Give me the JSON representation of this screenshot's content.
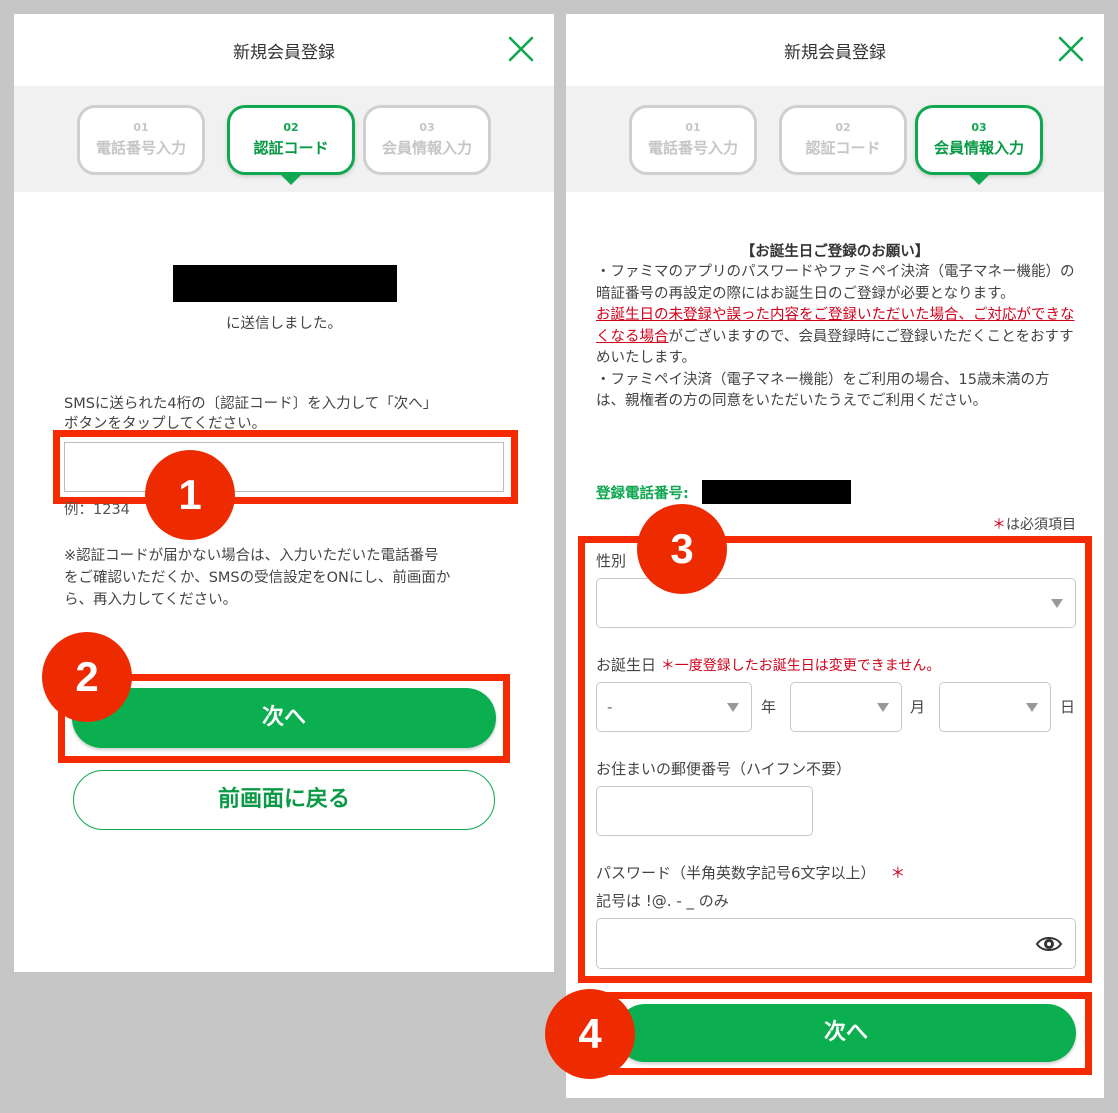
{
  "header": {
    "title": "新規会員登録"
  },
  "steps": [
    {
      "num": "01",
      "label": "電話番号入力"
    },
    {
      "num": "02",
      "label": "認証コード"
    },
    {
      "num": "03",
      "label": "会員情報入力"
    }
  ],
  "left": {
    "sent_text": "に送信しました。",
    "instruction_line1": "SMSに送られた4桁の〔認証コード〕を入力して「次へ」",
    "instruction_line2": "ボタンをタップしてください。",
    "example": "例：1234",
    "note_line1": "※認証コードが届かない場合は、入力いただいた電話番号",
    "note_line2": "をご確認いただくか、SMSの受信設定をONにし、前画面か",
    "note_line3": "ら、再入力してください。",
    "next_label": "次へ",
    "back_label": "前画面に戻る"
  },
  "right": {
    "notice_title": "【お誕生日ご登録のお願い】",
    "notice_p1": "・ファミマのアプリのパスワードやファミペイ決済（電子マネー機能）の暗証番号の再設定の際にはお誕生日のご登録が必要となります。",
    "notice_warn": "お誕生日の未登録や誤った内容をご登録いただいた場合、ご対応ができなくなる場合",
    "notice_p2_rest": "がございますので、会員登録時にご登録いただくことをおすすめいたします。",
    "notice_p3": "・ファミペイ決済（電子マネー機能）をご利用の場合、15歳未満の方は、親権者の方の同意をいただいたうえでご利用ください。",
    "phone_label": "登録電話番号:",
    "required_star": "＊",
    "required_note": "は必須項目",
    "gender_label": "性別",
    "birthday_label": "お誕生日",
    "birthday_warn": "＊一度登録したお誕生日は変更できません。",
    "year_value": "-",
    "year_unit": "年",
    "month_unit": "月",
    "day_unit": "日",
    "zip_label": "お住まいの郵便番号（ハイフン不要）",
    "password_label": "パスワード（半角英数字記号6文字以上）",
    "password_star": "＊",
    "password_hint": "記号は !@. - _ のみ",
    "next_label": "次へ"
  },
  "badges": [
    "1",
    "2",
    "3",
    "4"
  ],
  "colors": {
    "brand_green": "#0baf50",
    "highlight_red": "#f52a00",
    "warning_red": "#d0021b"
  },
  "icons": {
    "close": "close-icon",
    "eye": "eye-icon",
    "caret": "chevron-down-icon"
  }
}
